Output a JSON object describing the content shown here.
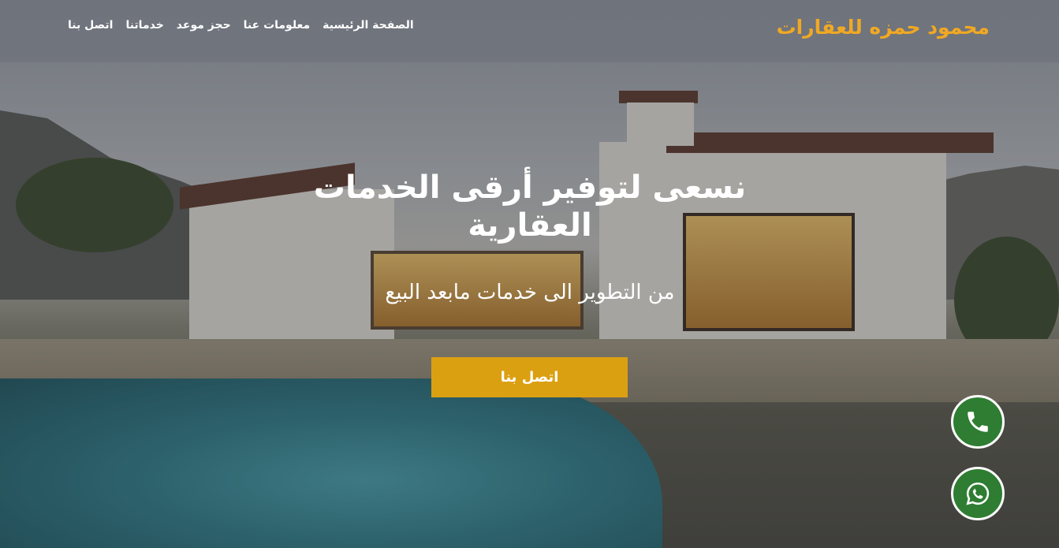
{
  "header": {
    "brand": "محمود حمزه للعقارات",
    "nav": [
      "الصفحة الرئيسية",
      "معلومات عنا",
      "حجز موعد",
      "خدماتنا",
      "اتصل بنا"
    ]
  },
  "hero": {
    "title": "نسعى لتوفير أرقى الخدمات العقارية",
    "subtitle": "من التطوير الى خدمات مابعد البيع",
    "cta_label": "اتصل بنا"
  },
  "floating": {
    "phone_icon": "phone-icon",
    "whatsapp_icon": "whatsapp-icon"
  },
  "colors": {
    "brand": "#f0a824",
    "cta": "#dba012",
    "fab": "#2e7d32"
  }
}
